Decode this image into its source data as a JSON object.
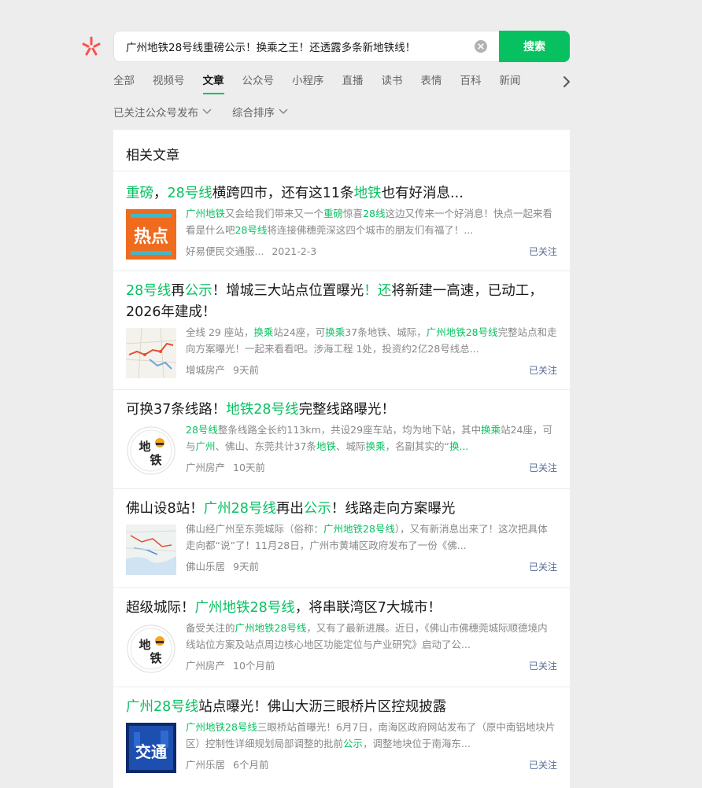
{
  "search": {
    "query": "广州地铁28号线重磅公示！换乘之王！还透露多条新地铁线！",
    "button_label": "搜索"
  },
  "tabs": [
    {
      "label": "全部"
    },
    {
      "label": "视频号"
    },
    {
      "label": "文章"
    },
    {
      "label": "公众号"
    },
    {
      "label": "小程序"
    },
    {
      "label": "直播"
    },
    {
      "label": "读书"
    },
    {
      "label": "表情"
    },
    {
      "label": "百科"
    },
    {
      "label": "新闻"
    }
  ],
  "active_tab": "文章",
  "filters": [
    {
      "label": "已关注公众号发布"
    },
    {
      "label": "综合排序"
    }
  ],
  "section": {
    "title": "相关文章"
  },
  "results": [
    {
      "title": [
        {
          "t": "重磅",
          "h": true
        },
        {
          "t": "，",
          "h": false
        },
        {
          "t": "28号线",
          "h": true
        },
        {
          "t": "横跨四市，还有这11条",
          "h": false
        },
        {
          "t": "地铁",
          "h": true
        },
        {
          "t": "也有好消息...",
          "h": false
        }
      ],
      "summary": [
        {
          "t": "广州地铁",
          "h": true
        },
        {
          "t": "又会给我们带来又一个",
          "h": false
        },
        {
          "t": "重磅",
          "h": true
        },
        {
          "t": "惊喜",
          "h": false
        },
        {
          "t": "28线",
          "h": true
        },
        {
          "t": "这边又传来一个好消息！快点一起来看看是什么吧",
          "h": false
        },
        {
          "t": "28号线",
          "h": true
        },
        {
          "t": "将连接佛穗莞深这四个城市的朋友们有福了！...",
          "h": false
        }
      ],
      "source": "好易便民交通服...",
      "time": "2021-2-3",
      "followed": "已关注",
      "thumb_icon": "hot-topic-thumbnail",
      "thumb_text": "热点"
    },
    {
      "title": [
        {
          "t": "28号线",
          "h": true
        },
        {
          "t": "再",
          "h": false
        },
        {
          "t": "公示",
          "h": true
        },
        {
          "t": "！增城三大站点位置曝光",
          "h": false
        },
        {
          "t": "！还",
          "h": true
        },
        {
          "t": "将新建一高速，已动工，2026年建成！",
          "h": false
        }
      ],
      "summary": [
        {
          "t": "全线 29 座站，",
          "h": false
        },
        {
          "t": "换乘",
          "h": true
        },
        {
          "t": "站24座，可",
          "h": false
        },
        {
          "t": "换乘",
          "h": true
        },
        {
          "t": "37条地铁、城际，",
          "h": false
        },
        {
          "t": "广州地铁28号线",
          "h": true
        },
        {
          "t": "完整站点和走向方案曝光！一起来看看吧。涉海工程 1处，投资约2亿28号线总...",
          "h": false
        }
      ],
      "source": "增城房产",
      "time": "9天前",
      "followed": "已关注",
      "thumb_icon": "route-map-thumbnail",
      "thumb_text": ""
    },
    {
      "title": [
        {
          "t": "可换37条线路！",
          "h": false
        },
        {
          "t": "地铁28号线",
          "h": true
        },
        {
          "t": "完整线路曝光！",
          "h": false
        }
      ],
      "summary": [
        {
          "t": "28号线",
          "h": true
        },
        {
          "t": "整条线路全长约113km，共设29座车站，均为地下站，其中",
          "h": false
        },
        {
          "t": "换乘",
          "h": true
        },
        {
          "t": "站24座，可与",
          "h": false
        },
        {
          "t": "广州",
          "h": true
        },
        {
          "t": "、佛山、东莞共计37条",
          "h": false
        },
        {
          "t": "地铁",
          "h": true
        },
        {
          "t": "、城际",
          "h": false
        },
        {
          "t": "换乘",
          "h": true
        },
        {
          "t": "，名副其实的“",
          "h": false
        },
        {
          "t": "换...",
          "h": true
        }
      ],
      "source": "广州房产",
      "time": "10天前",
      "followed": "已关注",
      "thumb_icon": "metro-logo-thumbnail",
      "thumb_text": "地铁"
    },
    {
      "title": [
        {
          "t": "佛山设8站！",
          "h": false
        },
        {
          "t": "广州28号线",
          "h": true
        },
        {
          "t": "再出",
          "h": false
        },
        {
          "t": "公示",
          "h": true
        },
        {
          "t": "！线路走向方案曝光",
          "h": false
        }
      ],
      "summary": [
        {
          "t": "佛山经广州至东莞城际（俗称：",
          "h": false
        },
        {
          "t": "广州地铁28号线",
          "h": true
        },
        {
          "t": "），又有新消息出来了！这次把具体走向都“说”了！11月28日，广州市黄埔区政府发布了一份《佛...",
          "h": false
        }
      ],
      "source": "佛山乐居",
      "time": "9天前",
      "followed": "已关注",
      "thumb_icon": "city-map-thumbnail",
      "thumb_text": ""
    },
    {
      "title": [
        {
          "t": "超级城际！",
          "h": false
        },
        {
          "t": "广州地铁28号线",
          "h": true
        },
        {
          "t": "，将串联湾区7大城市！",
          "h": false
        }
      ],
      "summary": [
        {
          "t": "备受关注的",
          "h": false
        },
        {
          "t": "广州地铁28号线",
          "h": true
        },
        {
          "t": "，又有了最新进展。近日，《佛山市佛穗莞城际顺德境内线站位方案及站点周边核心地区功能定位与产业研究》启动了公...",
          "h": false
        }
      ],
      "source": "广州房产",
      "time": "10个月前",
      "followed": "已关注",
      "thumb_icon": "metro-logo-thumbnail",
      "thumb_text": "地铁"
    },
    {
      "title": [
        {
          "t": "广州28号线",
          "h": true
        },
        {
          "t": "站点曝光！佛山大沥三眼桥片区控规披露",
          "h": false
        }
      ],
      "summary": [
        {
          "t": "广州地铁28号线",
          "h": true
        },
        {
          "t": "三眼桥站首曝光！6月7日，南海区政府网站发布了（原中南铝地块片区）控制性详细规划局部调整的批前",
          "h": false
        },
        {
          "t": "公示",
          "h": true
        },
        {
          "t": "，调整地块位于南海东...",
          "h": false
        }
      ],
      "source": "广州乐居",
      "time": "6个月前",
      "followed": "已关注",
      "thumb_icon": "traffic-thumbnail",
      "thumb_text": "交通"
    }
  ],
  "colors": {
    "accent": "#07c160",
    "followed": "#576b95",
    "page_bg": "#ededed"
  }
}
